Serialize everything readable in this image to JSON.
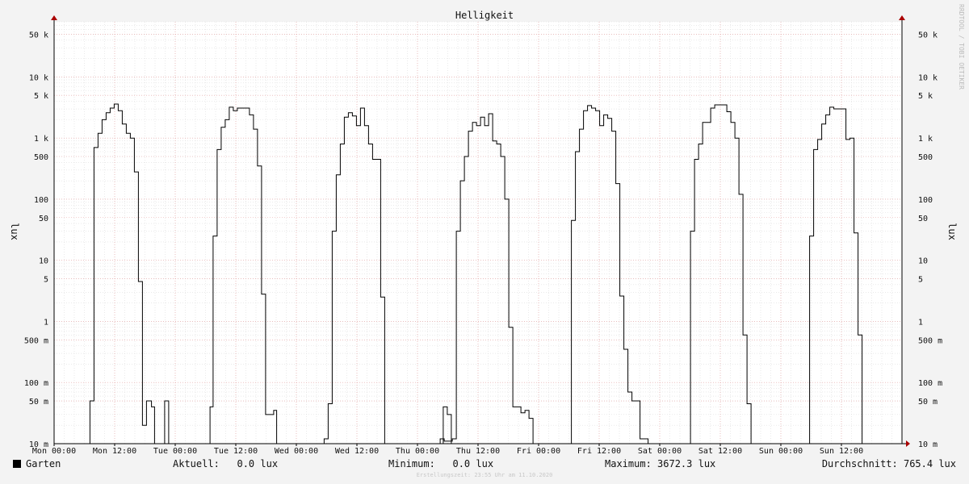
{
  "chart_data": {
    "type": "line",
    "title": "Helligkeit",
    "ylabel": "lux",
    "ylabel_right": "lux",
    "y_scale": "log",
    "ylim": [
      0.01,
      80000
    ],
    "xlim": [
      0,
      168
    ],
    "grid": true,
    "y_ticks": [
      {
        "value": 0.01,
        "label": "10 m"
      },
      {
        "value": 0.05,
        "label": "50 m"
      },
      {
        "value": 0.1,
        "label": "100 m"
      },
      {
        "value": 0.5,
        "label": "500 m"
      },
      {
        "value": 1,
        "label": "1"
      },
      {
        "value": 5,
        "label": "5"
      },
      {
        "value": 10,
        "label": "10"
      },
      {
        "value": 50,
        "label": "50"
      },
      {
        "value": 100,
        "label": "100"
      },
      {
        "value": 500,
        "label": "500"
      },
      {
        "value": 1000,
        "label": "1 k"
      },
      {
        "value": 5000,
        "label": "5 k"
      },
      {
        "value": 10000,
        "label": "10 k"
      },
      {
        "value": 50000,
        "label": "50 k"
      }
    ],
    "x_ticks": [
      {
        "value": 0,
        "label": "Mon 00:00"
      },
      {
        "value": 12,
        "label": "Mon 12:00"
      },
      {
        "value": 24,
        "label": "Tue 00:00"
      },
      {
        "value": 36,
        "label": "Tue 12:00"
      },
      {
        "value": 48,
        "label": "Wed 00:00"
      },
      {
        "value": 60,
        "label": "Wed 12:00"
      },
      {
        "value": 72,
        "label": "Thu 00:00"
      },
      {
        "value": 84,
        "label": "Thu 12:00"
      },
      {
        "value": 96,
        "label": "Fri 00:00"
      },
      {
        "value": 108,
        "label": "Fri 12:00"
      },
      {
        "value": 120,
        "label": "Sat 00:00"
      },
      {
        "value": 132,
        "label": "Sat 12:00"
      },
      {
        "value": 144,
        "label": "Sun 00:00"
      },
      {
        "value": 156,
        "label": "Sun 12:00"
      }
    ],
    "series": [
      {
        "name": "Garten",
        "color": "#000000",
        "points": [
          [
            0,
            0.01
          ],
          [
            7.1,
            0.01
          ],
          [
            7.1,
            0.05
          ],
          [
            7.9,
            0.05
          ],
          [
            7.9,
            700
          ],
          [
            8.7,
            700
          ],
          [
            8.7,
            1200
          ],
          [
            9.5,
            1200
          ],
          [
            9.5,
            2000
          ],
          [
            10.3,
            2000
          ],
          [
            10.3,
            2600
          ],
          [
            11.1,
            2600
          ],
          [
            11.1,
            3100
          ],
          [
            11.9,
            3100
          ],
          [
            11.9,
            3600
          ],
          [
            12.7,
            3600
          ],
          [
            12.7,
            2800
          ],
          [
            13.5,
            2800
          ],
          [
            13.5,
            1700
          ],
          [
            14.3,
            1700
          ],
          [
            14.3,
            1200
          ],
          [
            15.1,
            1200
          ],
          [
            15.1,
            1000
          ],
          [
            15.9,
            1000
          ],
          [
            15.9,
            280
          ],
          [
            16.7,
            280
          ],
          [
            16.7,
            4.5
          ],
          [
            17.5,
            4.5
          ],
          [
            17.5,
            0.02
          ],
          [
            18.3,
            0.02
          ],
          [
            18.3,
            0.05
          ],
          [
            19.3,
            0.05
          ],
          [
            19.3,
            0.04
          ],
          [
            19.9,
            0.04
          ],
          [
            19.9,
            0.01
          ],
          [
            21.9,
            0.01
          ],
          [
            21.9,
            0.05
          ],
          [
            22.7,
            0.05
          ],
          [
            22.7,
            0.01
          ],
          [
            30.9,
            0.01
          ],
          [
            30.9,
            0.04
          ],
          [
            31.5,
            0.04
          ],
          [
            31.5,
            25
          ],
          [
            32.3,
            25
          ],
          [
            32.3,
            650
          ],
          [
            33.1,
            650
          ],
          [
            33.1,
            1500
          ],
          [
            33.9,
            1500
          ],
          [
            33.9,
            2000
          ],
          [
            34.7,
            2000
          ],
          [
            34.7,
            3200
          ],
          [
            35.5,
            3200
          ],
          [
            35.5,
            2800
          ],
          [
            36.3,
            2800
          ],
          [
            36.3,
            3100
          ],
          [
            38.7,
            3100
          ],
          [
            38.7,
            2400
          ],
          [
            39.5,
            2400
          ],
          [
            39.5,
            1400
          ],
          [
            40.3,
            1400
          ],
          [
            40.3,
            350
          ],
          [
            41.1,
            350
          ],
          [
            41.1,
            2.8
          ],
          [
            41.9,
            2.8
          ],
          [
            41.9,
            0.03
          ],
          [
            43.5,
            0.03
          ],
          [
            43.5,
            0.035
          ],
          [
            44.1,
            0.035
          ],
          [
            44.1,
            0.01
          ],
          [
            53.5,
            0.01
          ],
          [
            53.5,
            0.012
          ],
          [
            54.3,
            0.012
          ],
          [
            54.3,
            0.045
          ],
          [
            55.1,
            0.045
          ],
          [
            55.1,
            30
          ],
          [
            55.9,
            30
          ],
          [
            55.9,
            250
          ],
          [
            56.7,
            250
          ],
          [
            56.7,
            800
          ],
          [
            57.5,
            800
          ],
          [
            57.5,
            2200
          ],
          [
            58.3,
            2200
          ],
          [
            58.3,
            2600
          ],
          [
            59.1,
            2600
          ],
          [
            59.1,
            2300
          ],
          [
            59.9,
            2300
          ],
          [
            59.9,
            1600
          ],
          [
            60.7,
            1600
          ],
          [
            60.7,
            3100
          ],
          [
            61.5,
            3100
          ],
          [
            61.5,
            1600
          ],
          [
            62.3,
            1600
          ],
          [
            62.3,
            800
          ],
          [
            63.1,
            800
          ],
          [
            63.1,
            450
          ],
          [
            64.7,
            450
          ],
          [
            64.7,
            2.5
          ],
          [
            65.5,
            2.5
          ],
          [
            65.5,
            0.01
          ],
          [
            76.5,
            0.01
          ],
          [
            76.5,
            0.012
          ],
          [
            77.3,
            0.012
          ],
          [
            77.3,
            0.011
          ],
          [
            78.9,
            0.011
          ],
          [
            78.9,
            0.012
          ],
          [
            79.7,
            0.012
          ],
          [
            79.7,
            30
          ],
          [
            80.5,
            30
          ],
          [
            80.5,
            200
          ],
          [
            81.3,
            200
          ],
          [
            81.3,
            500
          ],
          [
            82.1,
            500
          ],
          [
            82.1,
            1300
          ],
          [
            82.9,
            1300
          ],
          [
            82.9,
            1800
          ],
          [
            83.7,
            1800
          ],
          [
            83.7,
            1600
          ],
          [
            84.5,
            1600
          ],
          [
            84.5,
            2200
          ],
          [
            85.3,
            2200
          ],
          [
            85.3,
            1600
          ],
          [
            86.1,
            1600
          ],
          [
            86.1,
            2500
          ],
          [
            86.9,
            2500
          ],
          [
            86.9,
            900
          ],
          [
            87.7,
            900
          ],
          [
            87.7,
            800
          ],
          [
            88.5,
            800
          ],
          [
            88.5,
            500
          ],
          [
            89.3,
            500
          ],
          [
            89.3,
            100
          ],
          [
            90.1,
            100
          ],
          [
            90.1,
            0.8
          ],
          [
            90.9,
            0.8
          ],
          [
            90.9,
            0.04
          ],
          [
            92.5,
            0.04
          ],
          [
            92.5,
            0.032
          ],
          [
            93.3,
            0.032
          ],
          [
            93.3,
            0.035
          ],
          [
            94.1,
            0.035
          ],
          [
            94.1,
            0.026
          ],
          [
            94.9,
            0.026
          ],
          [
            94.9,
            0.01
          ],
          [
            77.1,
            0.01
          ],
          [
            77.1,
            0.04
          ],
          [
            77.9,
            0.04
          ],
          [
            77.9,
            0.03
          ],
          [
            78.7,
            0.03
          ],
          [
            78.7,
            0.01
          ],
          [
            102.5,
            0.01
          ],
          [
            102.5,
            45
          ],
          [
            103.3,
            45
          ],
          [
            103.3,
            600
          ],
          [
            104.1,
            600
          ],
          [
            104.1,
            1400
          ],
          [
            104.9,
            1400
          ],
          [
            104.9,
            2800
          ],
          [
            105.7,
            2800
          ],
          [
            105.7,
            3400
          ],
          [
            106.5,
            3400
          ],
          [
            106.5,
            3100
          ],
          [
            107.3,
            3100
          ],
          [
            107.3,
            2800
          ],
          [
            108.1,
            2800
          ],
          [
            108.1,
            1600
          ],
          [
            108.9,
            1600
          ],
          [
            108.9,
            2400
          ],
          [
            109.7,
            2400
          ],
          [
            109.7,
            2100
          ],
          [
            110.5,
            2100
          ],
          [
            110.5,
            1300
          ],
          [
            111.3,
            1300
          ],
          [
            111.3,
            180
          ],
          [
            112.1,
            180
          ],
          [
            112.1,
            2.6
          ],
          [
            112.9,
            2.6
          ],
          [
            112.9,
            0.35
          ],
          [
            113.7,
            0.35
          ],
          [
            113.7,
            0.07
          ],
          [
            114.5,
            0.07
          ],
          [
            114.5,
            0.05
          ],
          [
            116.1,
            0.05
          ],
          [
            116.1,
            0.012
          ],
          [
            117.7,
            0.012
          ],
          [
            117.7,
            0.01
          ],
          [
            126.1,
            0.01
          ],
          [
            126.1,
            30
          ],
          [
            126.9,
            30
          ],
          [
            126.9,
            450
          ],
          [
            127.7,
            450
          ],
          [
            127.7,
            800
          ],
          [
            128.5,
            800
          ],
          [
            128.5,
            1800
          ],
          [
            130.1,
            1800
          ],
          [
            130.1,
            3100
          ],
          [
            130.9,
            3100
          ],
          [
            130.9,
            3500
          ],
          [
            133.3,
            3500
          ],
          [
            133.3,
            2700
          ],
          [
            134.1,
            2700
          ],
          [
            134.1,
            1800
          ],
          [
            134.9,
            1800
          ],
          [
            134.9,
            1000
          ],
          [
            135.7,
            1000
          ],
          [
            135.7,
            120
          ],
          [
            136.5,
            120
          ],
          [
            136.5,
            0.6
          ],
          [
            137.3,
            0.6
          ],
          [
            137.3,
            0.045
          ],
          [
            138.1,
            0.045
          ],
          [
            138.1,
            0.01
          ],
          [
            149.7,
            0.01
          ],
          [
            149.7,
            25
          ],
          [
            150.5,
            25
          ],
          [
            150.5,
            650
          ],
          [
            151.3,
            650
          ],
          [
            151.3,
            950
          ],
          [
            152.1,
            950
          ],
          [
            152.1,
            1700
          ],
          [
            152.9,
            1700
          ],
          [
            152.9,
            2400
          ],
          [
            153.7,
            2400
          ],
          [
            153.7,
            3200
          ],
          [
            154.5,
            3200
          ],
          [
            154.5,
            3000
          ],
          [
            156.9,
            3000
          ],
          [
            156.9,
            950
          ],
          [
            157.7,
            950
          ],
          [
            157.7,
            1000
          ],
          [
            158.5,
            1000
          ],
          [
            158.5,
            28
          ],
          [
            159.3,
            28
          ],
          [
            159.3,
            0.6
          ],
          [
            160.1,
            0.6
          ],
          [
            160.1,
            0.01
          ],
          [
            168,
            0.01
          ]
        ]
      }
    ]
  },
  "legend": {
    "name": "Garten",
    "color": "#000000"
  },
  "stats": {
    "current": "Aktuell:   0.0 lux",
    "minimum": "Minimum:   0.0 lux",
    "maximum": "Maximum: 3672.3 lux",
    "average": "Durchschnitt: 765.4 lux"
  },
  "side_label": "RRDTOOL / TOBI OETIKER",
  "created": "Erstellungszeit: 23:55 Uhr am 11.10.2020",
  "colors": {
    "background": "#f3f3f3",
    "plot_background": "#ffffff",
    "minor_grid": "#dddddd",
    "major_grid": "#e6a0a0",
    "axis": "#000000",
    "arrow": "#aa0000"
  }
}
